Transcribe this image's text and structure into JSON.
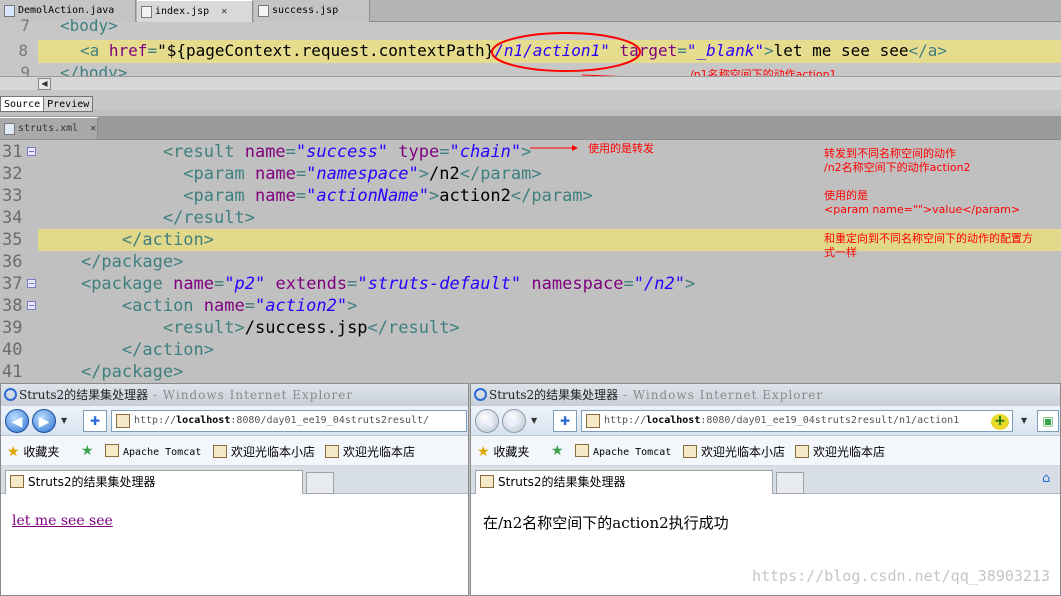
{
  "top_editor": {
    "tabs": [
      {
        "label": "DemolAction.java"
      },
      {
        "label": "index.jsp"
      },
      {
        "label": "success.jsp"
      }
    ],
    "lines": [
      {
        "num": "7",
        "text": "<body>"
      },
      {
        "num": "8"
      },
      {
        "num": "9",
        "text": "</body>"
      }
    ],
    "line8": {
      "open": "<a ",
      "attr1": "href",
      "eq1": "=",
      "val1a": "\"${pageContext.request.contextPath}",
      "val1b": "/n1/action1\"",
      "attr2": "target",
      "eq2": "=",
      "val2": "\"_blank\"",
      "close1": ">",
      "body": "let me see see",
      "close2": "</a>"
    },
    "subtabs": [
      "Source",
      "Preview"
    ],
    "annotation": "/n1名称空间下的动作action1"
  },
  "xml_editor": {
    "tab_label": "struts.xml",
    "lines": [
      {
        "num": "31",
        "ind": "            ",
        "parts": [
          [
            "tag",
            "<result "
          ],
          [
            "attr",
            "name"
          ],
          [
            "tag",
            "="
          ],
          [
            "str",
            "\"success\""
          ],
          [
            "tag",
            " "
          ],
          [
            "attr",
            "type"
          ],
          [
            "tag",
            "="
          ],
          [
            "str",
            "\"chain\""
          ],
          [
            "tag",
            ">"
          ]
        ]
      },
      {
        "num": "32",
        "ind": "              ",
        "parts": [
          [
            "tag",
            "<param "
          ],
          [
            "attr",
            "name"
          ],
          [
            "tag",
            "="
          ],
          [
            "str",
            "\"namespace\""
          ],
          [
            "tag",
            ">"
          ],
          [
            "txt",
            "/n2"
          ],
          [
            "tag",
            "</param>"
          ]
        ]
      },
      {
        "num": "33",
        "ind": "              ",
        "parts": [
          [
            "tag",
            "<param "
          ],
          [
            "attr",
            "name"
          ],
          [
            "tag",
            "="
          ],
          [
            "str",
            "\"actionName\""
          ],
          [
            "tag",
            ">"
          ],
          [
            "txt",
            "action2"
          ],
          [
            "tag",
            "</param>"
          ]
        ]
      },
      {
        "num": "34",
        "ind": "            ",
        "parts": [
          [
            "tag",
            "</result>"
          ]
        ]
      },
      {
        "num": "35",
        "ind": "        ",
        "parts": [
          [
            "tag",
            "</action>"
          ]
        ]
      },
      {
        "num": "36",
        "ind": "    ",
        "parts": [
          [
            "tag",
            "</package>"
          ]
        ]
      },
      {
        "num": "37",
        "ind": "    ",
        "parts": [
          [
            "tag",
            "<package "
          ],
          [
            "attr",
            "name"
          ],
          [
            "tag",
            "="
          ],
          [
            "str",
            "\"p2\""
          ],
          [
            "tag",
            " "
          ],
          [
            "attr",
            "extends"
          ],
          [
            "tag",
            "="
          ],
          [
            "str",
            "\"struts-default\""
          ],
          [
            "tag",
            " "
          ],
          [
            "attr",
            "namespace"
          ],
          [
            "tag",
            "="
          ],
          [
            "str",
            "\"/n2\""
          ],
          [
            "tag",
            ">"
          ]
        ]
      },
      {
        "num": "38",
        "ind": "        ",
        "parts": [
          [
            "tag",
            "<action "
          ],
          [
            "attr",
            "name"
          ],
          [
            "tag",
            "="
          ],
          [
            "str",
            "\"action2\""
          ],
          [
            "tag",
            ">"
          ]
        ]
      },
      {
        "num": "39",
        "ind": "            ",
        "parts": [
          [
            "tag",
            "<result>"
          ],
          [
            "txt",
            "/success.jsp"
          ],
          [
            "tag",
            "</result>"
          ]
        ]
      },
      {
        "num": "40",
        "ind": "        ",
        "parts": [
          [
            "tag",
            "</action>"
          ]
        ]
      },
      {
        "num": "41",
        "ind": "    ",
        "parts": [
          [
            "tag",
            "</package>"
          ]
        ]
      }
    ],
    "annotations": {
      "chain": "使用的是转发",
      "forward_1": "转发到不同名称空间的动作",
      "forward_2": "/n2名称空间下的动作action2",
      "used_1": "使用的是",
      "used_2": "<param name=\"\">value</param>",
      "same_1": "和重定向到不同名称空间下的动作的配置方",
      "same_2": "式一样"
    }
  },
  "browser_left": {
    "title": "Struts2的结果集处理器",
    "title_suffix": " - Windows Internet Explorer",
    "url_prefix": "http://",
    "url_host": "localhost",
    "url_rest": ":8080/day01_ee19_04struts2result/",
    "favorites": "收藏夹",
    "fav_links": [
      "Apache Tomcat",
      "欢迎光临本小店",
      "欢迎光临本店"
    ],
    "tab_title": "Struts2的结果集处理器",
    "link_text": "let me see see"
  },
  "browser_right": {
    "title": "Struts2的结果集处理器",
    "title_suffix": " - Windows Internet Explorer",
    "url_prefix": "http://",
    "url_host": "localhost",
    "url_rest": ":8080/day01_ee19_04struts2result/n1/action1",
    "favorites": "收藏夹",
    "fav_links": [
      "Apache Tomcat",
      "欢迎光临本小店",
      "欢迎光临本店"
    ],
    "tab_title": "Struts2的结果集处理器",
    "message": "在/n2名称空间下的action2执行成功",
    "watermark": "https://blog.csdn.net/qq_38903213"
  },
  "colors": {
    "annotation": "#ff0000",
    "highlight_line": "#e2d88a",
    "xml_tag": "#3f7f7f",
    "xml_attr": "#7f007f",
    "xml_string": "#2a00ff"
  }
}
